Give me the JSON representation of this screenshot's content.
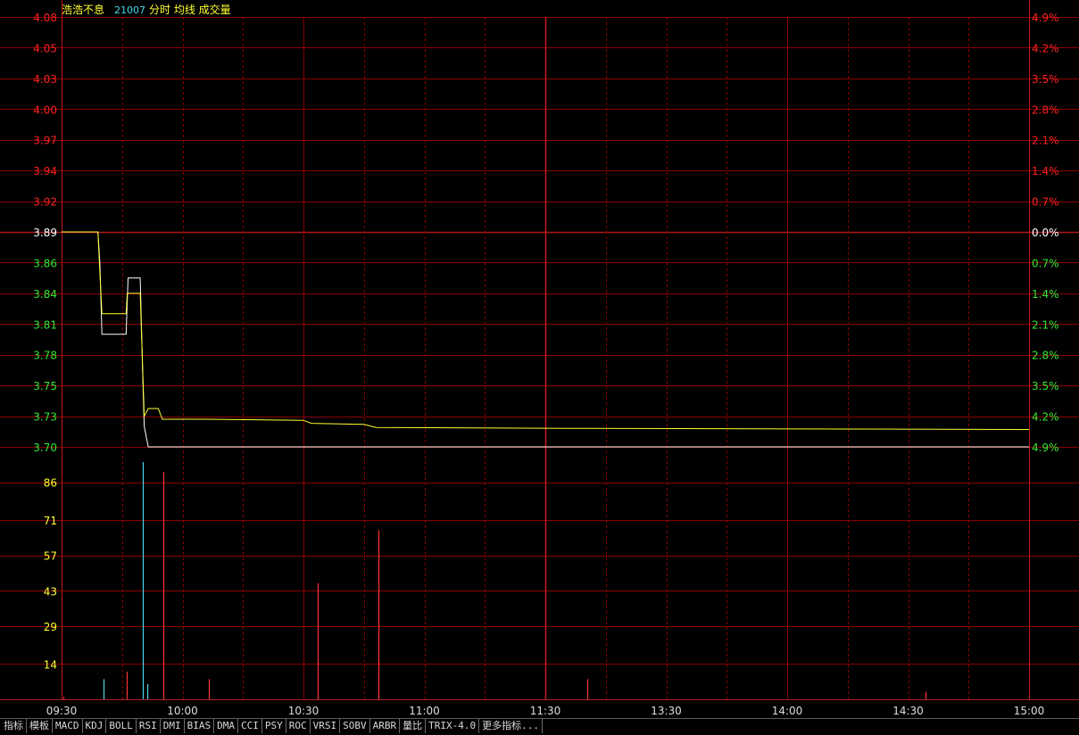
{
  "header": {
    "name": "浩浩不息",
    "code": "21007",
    "modes": "分时 均线 成交量"
  },
  "colors": {
    "grid": "#8b0000",
    "up": "#ff2020",
    "down": "#33e833",
    "flat": "#ffffff",
    "price_line": "#ffffff",
    "avg_line": "#ffff33",
    "vol_up": "#ff3333",
    "vol_down": "#44d8e8",
    "axis_text": "#ff2020",
    "time_text": "#dddddd"
  },
  "chart_data": {
    "type": "line",
    "prev_close": 3.89,
    "price_axis": {
      "ylim": [
        3.7,
        4.08
      ],
      "ticks": [
        {
          "label": "4.08",
          "value": 4.08
        },
        {
          "label": "4.05",
          "value": 4.05
        },
        {
          "label": "4.03",
          "value": 4.03
        },
        {
          "label": "4.00",
          "value": 4.0
        },
        {
          "label": "3.97",
          "value": 3.97
        },
        {
          "label": "3.94",
          "value": 3.94
        },
        {
          "label": "3.92",
          "value": 3.92
        },
        {
          "label": "3.89",
          "value": 3.89
        },
        {
          "label": "3.86",
          "value": 3.86
        },
        {
          "label": "3.84",
          "value": 3.84
        },
        {
          "label": "3.81",
          "value": 3.81
        },
        {
          "label": "3.78",
          "value": 3.78
        },
        {
          "label": "3.75",
          "value": 3.75
        },
        {
          "label": "3.73",
          "value": 3.73
        },
        {
          "label": "3.70",
          "value": 3.7
        }
      ],
      "pct_labels": [
        "4.9%",
        "4.2%",
        "3.5%",
        "2.8%",
        "2.1%",
        "1.4%",
        "0.7%",
        "0.0%",
        "0.7%",
        "1.4%",
        "2.1%",
        "2.8%",
        "3.5%",
        "4.2%",
        "4.9%"
      ]
    },
    "volume_axis": {
      "ylim": [
        0,
        100
      ],
      "ticks": [
        "86",
        "71",
        "57",
        "43",
        "29",
        "14"
      ],
      "tick_values": [
        86,
        71,
        57,
        43,
        29,
        14
      ]
    },
    "time_axis": {
      "minutes": 240,
      "labels": [
        {
          "label": "09:30",
          "minute": 0
        },
        {
          "label": "10:00",
          "minute": 30
        },
        {
          "label": "10:30",
          "minute": 60
        },
        {
          "label": "11:00",
          "minute": 90
        },
        {
          "label": "11:30",
          "minute": 120
        },
        {
          "label": "13:30",
          "minute": 150
        },
        {
          "label": "14:00",
          "minute": 180
        },
        {
          "label": "14:30",
          "minute": 210
        },
        {
          "label": "15:00",
          "minute": 240
        }
      ]
    },
    "series": [
      {
        "key": "price",
        "points": [
          [
            0,
            3.89
          ],
          [
            9,
            3.89
          ],
          [
            9.5,
            3.86
          ],
          [
            10,
            3.8
          ],
          [
            15,
            3.8
          ],
          [
            16,
            3.8
          ],
          [
            16.5,
            3.85
          ],
          [
            19.5,
            3.85
          ],
          [
            20,
            3.78
          ],
          [
            20.5,
            3.72
          ],
          [
            21.5,
            3.7
          ],
          [
            240,
            3.7
          ]
        ]
      },
      {
        "key": "average",
        "points": [
          [
            0,
            3.89
          ],
          [
            9,
            3.89
          ],
          [
            10,
            3.82
          ],
          [
            16,
            3.82
          ],
          [
            16.3,
            3.84
          ],
          [
            19.5,
            3.84
          ],
          [
            20.5,
            3.73
          ],
          [
            21.5,
            3.735
          ],
          [
            24,
            3.735
          ],
          [
            25,
            3.727
          ],
          [
            36,
            3.727
          ],
          [
            60,
            3.726
          ],
          [
            62,
            3.723
          ],
          [
            75,
            3.722
          ],
          [
            78,
            3.719
          ],
          [
            130,
            3.718
          ],
          [
            240,
            3.717
          ]
        ]
      }
    ],
    "volume": [
      {
        "minute": 0.5,
        "value": 1,
        "dir": "up"
      },
      {
        "minute": 10.3,
        "value": 8,
        "dir": "down"
      },
      {
        "minute": 16.2,
        "value": 11,
        "dir": "up"
      },
      {
        "minute": 20.2,
        "value": 94,
        "dir": "down"
      },
      {
        "minute": 21.2,
        "value": 6,
        "dir": "down"
      },
      {
        "minute": 25.2,
        "value": 90,
        "dir": "up"
      },
      {
        "minute": 36.5,
        "value": 8,
        "dir": "up"
      },
      {
        "minute": 63.5,
        "value": 46,
        "dir": "up"
      },
      {
        "minute": 78.6,
        "value": 67,
        "dir": "up"
      },
      {
        "minute": 130.3,
        "value": 8,
        "dir": "up"
      },
      {
        "minute": 214.3,
        "value": 3,
        "dir": "up"
      }
    ]
  },
  "tabs": [
    "指标",
    "模板",
    "MACD",
    "KDJ",
    "BOLL",
    "RSI",
    "DMI",
    "BIAS",
    "DMA",
    "CCI",
    "PSY",
    "ROC",
    "VRSI",
    "SOBV",
    "ARBR",
    "量比",
    "TRIX-4.0",
    "更多指标..."
  ]
}
